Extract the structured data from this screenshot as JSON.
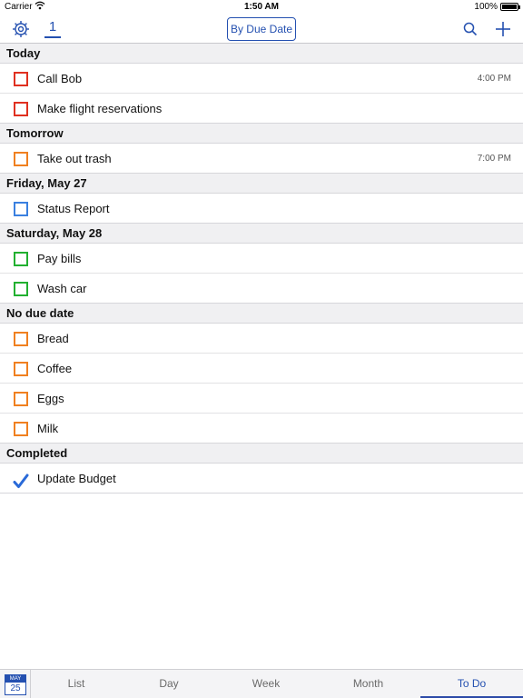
{
  "status_bar": {
    "carrier": "Carrier",
    "time": "1:50 AM",
    "battery": "100%"
  },
  "toolbar": {
    "selected_count": "1",
    "sort_label": "By Due Date"
  },
  "sections": [
    {
      "title": "Today",
      "tasks": [
        {
          "title": "Call Bob",
          "time": "4:00 PM",
          "color": "#e03020"
        },
        {
          "title": "Make flight reservations",
          "time": "",
          "color": "#e03020"
        }
      ]
    },
    {
      "title": "Tomorrow",
      "tasks": [
        {
          "title": "Take out trash",
          "time": "7:00 PM",
          "color": "#f08020"
        }
      ]
    },
    {
      "title": "Friday, May 27",
      "tasks": [
        {
          "title": "Status Report",
          "time": "",
          "color": "#3a80e0"
        }
      ]
    },
    {
      "title": "Saturday, May 28",
      "tasks": [
        {
          "title": "Pay bills",
          "time": "",
          "color": "#22b030"
        },
        {
          "title": "Wash car",
          "time": "",
          "color": "#22b030"
        }
      ]
    },
    {
      "title": "No due date",
      "tasks": [
        {
          "title": "Bread",
          "time": "",
          "color": "#f08020"
        },
        {
          "title": "Coffee",
          "time": "",
          "color": "#f08020"
        },
        {
          "title": "Eggs",
          "time": "",
          "color": "#f08020"
        },
        {
          "title": "Milk",
          "time": "",
          "color": "#f08020"
        }
      ]
    },
    {
      "title": "Completed",
      "tasks": [
        {
          "title": "Update Budget",
          "time": "",
          "color": "#2a6ad8",
          "completed": true
        }
      ]
    }
  ],
  "tabbar": {
    "calendar_month": "MAY",
    "calendar_day": "25",
    "tabs": [
      "List",
      "Day",
      "Week",
      "Month",
      "To Do"
    ],
    "active_tab": "To Do"
  },
  "colors": {
    "accent": "#2450b0"
  }
}
